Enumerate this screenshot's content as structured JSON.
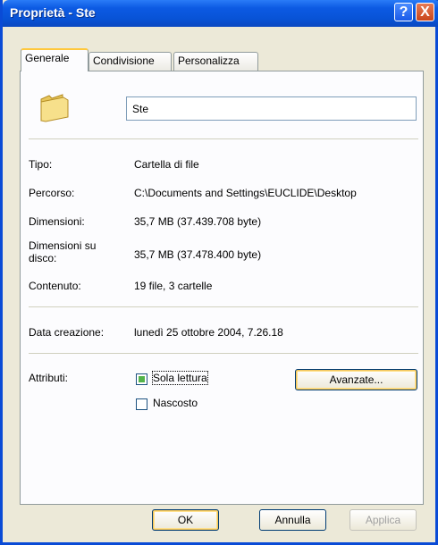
{
  "window": {
    "title": "Proprietà - Ste",
    "help_glyph": "?",
    "close_glyph": "X"
  },
  "tabs": [
    {
      "label": "Generale"
    },
    {
      "label": "Condivisione"
    },
    {
      "label": "Personalizza"
    }
  ],
  "general": {
    "name_value": "Ste",
    "rows": [
      {
        "label": "Tipo:",
        "value": "Cartella di file"
      },
      {
        "label": "Percorso:",
        "value": "C:\\Documents and Settings\\EUCLIDE\\Desktop"
      },
      {
        "label": "Dimensioni:",
        "value": "35,7 MB (37.439.708 byte)"
      },
      {
        "label": "Dimensioni su disco:",
        "value": "35,7 MB (37.478.400 byte)"
      },
      {
        "label": "Contenuto:",
        "value": "19 file, 3 cartelle"
      }
    ],
    "created_label": "Data creazione:",
    "created_value": "lunedì 25 ottobre 2004, 7.26.18",
    "attributes_label": "Attributi:",
    "readonly_label": "Sola lettura",
    "hidden_label": "Nascosto",
    "advanced_label": "Avanzate..."
  },
  "buttons": {
    "ok": "OK",
    "cancel": "Annulla",
    "apply": "Applica"
  },
  "icons": {
    "folder": "folder-icon",
    "help": "help-icon",
    "close": "close-icon"
  },
  "colors": {
    "titlebar": "#0853d6",
    "tab_highlight": "#ffc83c",
    "check_fill": "#53b34a"
  }
}
